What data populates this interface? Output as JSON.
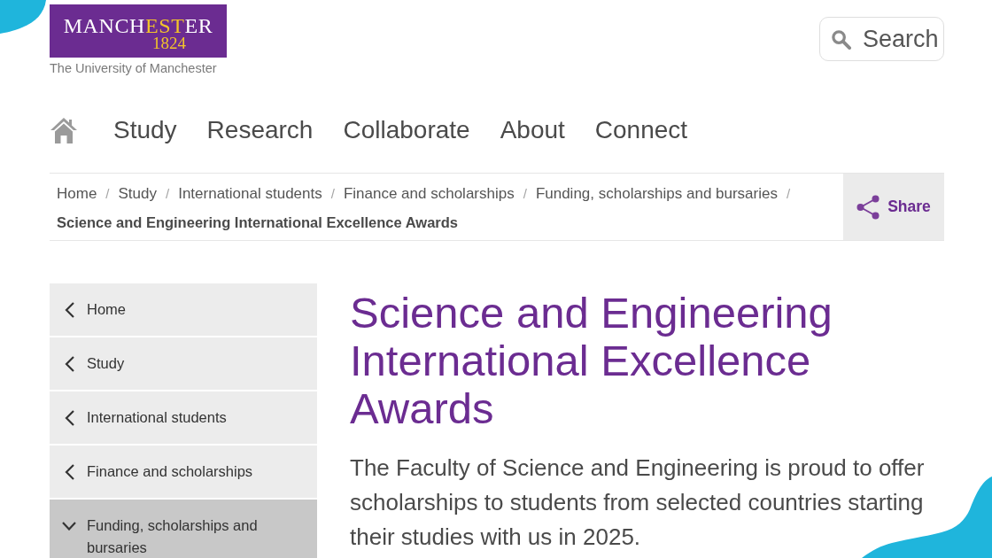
{
  "logo": {
    "wordmark_parts": [
      {
        "text": "MANCH",
        "highlighted": false
      },
      {
        "text": "EST",
        "highlighted": true
      },
      {
        "text": "ER",
        "highlighted": false
      }
    ],
    "year": "1824",
    "caption": "The University of Manchester"
  },
  "search": {
    "label": "Search"
  },
  "main_nav": {
    "items": [
      {
        "label": "Study"
      },
      {
        "label": "Research"
      },
      {
        "label": "Collaborate"
      },
      {
        "label": "About"
      },
      {
        "label": "Connect"
      }
    ]
  },
  "breadcrumb": {
    "items": [
      {
        "label": "Home",
        "separator": "/"
      },
      {
        "label": "Study",
        "separator": "/"
      },
      {
        "label": "International students",
        "separator": "/"
      },
      {
        "label": "Finance and scholarships",
        "separator": "/"
      },
      {
        "label": "Funding, scholarships and bursaries",
        "separator": "/"
      }
    ],
    "current": "Science and Engineering International Excellence Awards"
  },
  "share": {
    "label": "Share"
  },
  "sidebar": {
    "items": [
      {
        "label": "Home",
        "selected": false,
        "expanded": false
      },
      {
        "label": "Study",
        "selected": false,
        "expanded": false
      },
      {
        "label": "International students",
        "selected": false,
        "expanded": false
      },
      {
        "label": "Finance and scholarships",
        "selected": false,
        "expanded": false
      },
      {
        "label": "Funding, scholarships and bursaries",
        "selected": true,
        "expanded": true
      }
    ]
  },
  "page_title": "Science and Engineering International Excellence Awards",
  "intro": "The Faculty of Science and Engineering is proud to offer scholarships to students from selected countries starting their studies with us in 2025."
}
